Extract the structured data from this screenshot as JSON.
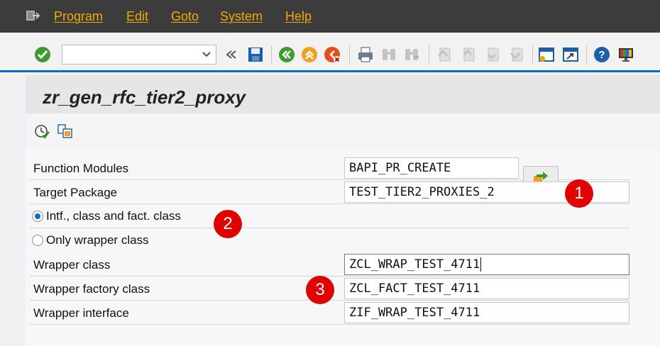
{
  "menu": {
    "icon": "exit-menu-icon",
    "items": [
      "Program",
      "Edit",
      "Goto",
      "System",
      "Help"
    ]
  },
  "toolbar": {
    "command_field": {
      "value": "",
      "placeholder": ""
    },
    "icons": [
      "enter-check-icon",
      "command-dropdown-icon",
      "hide-command-icon",
      "save-icon",
      "back-icon",
      "exit-icon",
      "cancel-icon",
      "print-icon",
      "find-icon",
      "find-next-icon",
      "first-page-icon",
      "previous-page-icon",
      "next-page-icon",
      "last-page-icon",
      "new-session-icon",
      "shortcut-icon",
      "help-icon",
      "layout-icon"
    ]
  },
  "title": "zr_gen_rfc_tier2_proxy",
  "app_toolbar": {
    "icons": [
      "execute-icon",
      "copy-icon"
    ]
  },
  "form": {
    "function_modules": {
      "label": "Function Modules",
      "value": "BAPI_PR_CREATE"
    },
    "target_package": {
      "label": "Target Package",
      "value": "TEST_TIER2_PROXIES_2"
    },
    "radio_intf": {
      "label": "Intf., class and fact. class",
      "selected": true
    },
    "radio_wrapper": {
      "label": "Only wrapper class",
      "selected": false
    },
    "wrapper_class": {
      "label": "Wrapper class",
      "value": "ZCL_WRAP_TEST_4711"
    },
    "wrapper_factory_class": {
      "label": "Wrapper factory class",
      "value": "ZCL_FACT_TEST_4711"
    },
    "wrapper_interface": {
      "label": "Wrapper interface",
      "value": "ZIF_WRAP_TEST_4711"
    }
  },
  "annotations": [
    "1",
    "2",
    "3"
  ],
  "colors": {
    "menubar": "#3c3c3c",
    "menu_text": "#f0ab00",
    "accent": "#0a6ed1",
    "badge": "#e00000"
  }
}
